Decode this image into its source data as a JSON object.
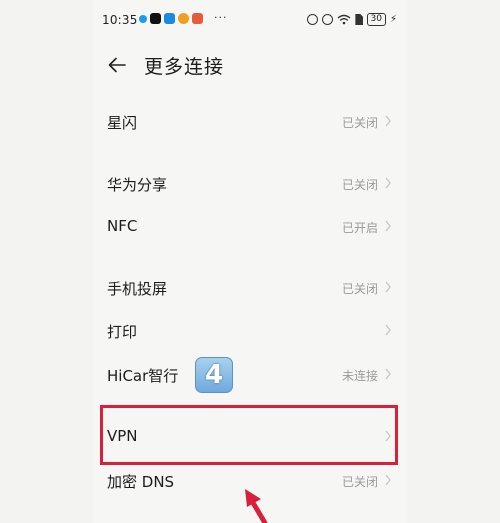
{
  "status_bar": {
    "time": "10:35",
    "dots": "···",
    "battery": "30",
    "app_icon_colors": [
      "#1d9bf0",
      "#111111",
      "#1e88e5",
      "#f0a020",
      "#e85b3a"
    ]
  },
  "header": {
    "title": "更多连接"
  },
  "rows": [
    {
      "label": "星闪",
      "value": "已关闭"
    },
    {
      "label": "华为分享",
      "value": "已关闭"
    },
    {
      "label": "NFC",
      "value": "已开启"
    },
    {
      "label": "手机投屏",
      "value": "已关闭"
    },
    {
      "label": "打印",
      "value": ""
    },
    {
      "label": "HiCar智行",
      "value": "未连接"
    },
    {
      "label": "VPN",
      "value": ""
    },
    {
      "label": "加密 DNS",
      "value": "已关闭"
    }
  ],
  "annotation": {
    "step_badge": "4",
    "highlight_color": "#d9203a"
  }
}
